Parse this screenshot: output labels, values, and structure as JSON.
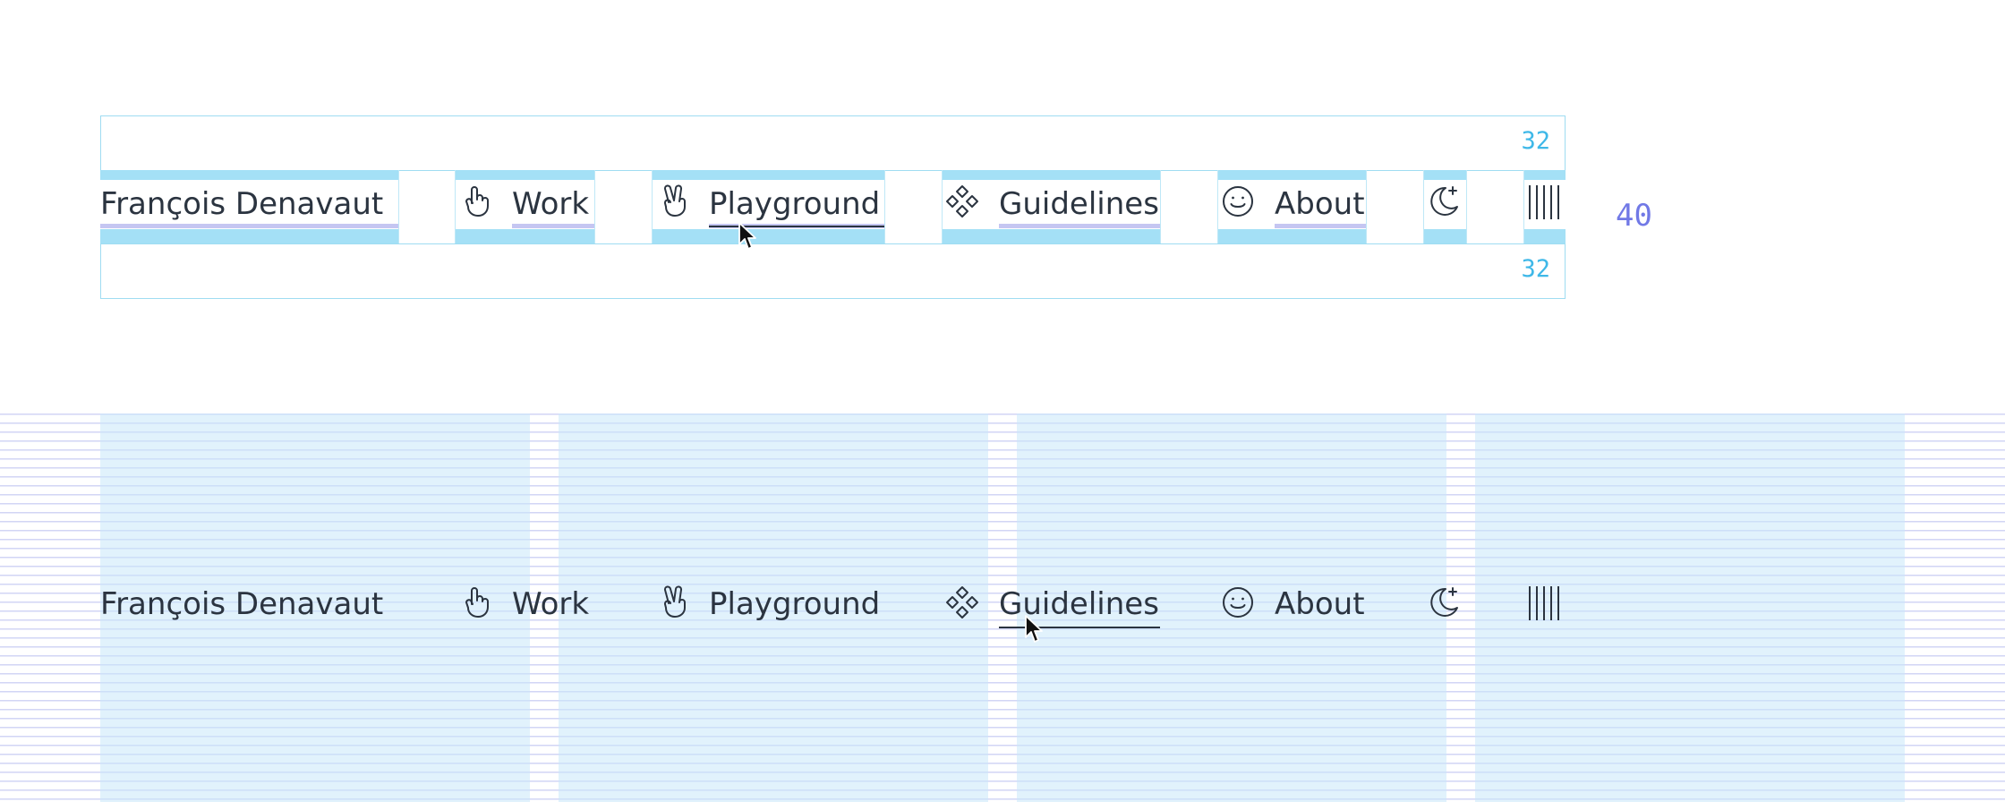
{
  "spec": {
    "padding_top_label": "32",
    "padding_bottom_label": "32",
    "height_label": "40"
  },
  "nav": {
    "brand": "François Denavaut",
    "items": [
      {
        "label": "Work",
        "icon": "hand-pointing-icon"
      },
      {
        "label": "Playground",
        "icon": "hand-peace-icon"
      },
      {
        "label": "Guidelines",
        "icon": "component-diamonds-icon"
      },
      {
        "label": "About",
        "icon": "smiley-icon"
      }
    ],
    "theme_toggle_icon": "moon-plus-icon",
    "menu_icon": "barcode-lines-icon"
  },
  "states": {
    "top_hovered": "Playground",
    "bottom_hovered": "Guidelines"
  },
  "colors": {
    "text": "#2b3440",
    "spec_band": "#a4e0f6",
    "spec_number": "#3fb8e8",
    "height_number": "#7179e6",
    "underline_spacing": "#c5c6f2",
    "grid_column": "#c8e8fa",
    "baseline_grid": "#d2d5f5"
  }
}
